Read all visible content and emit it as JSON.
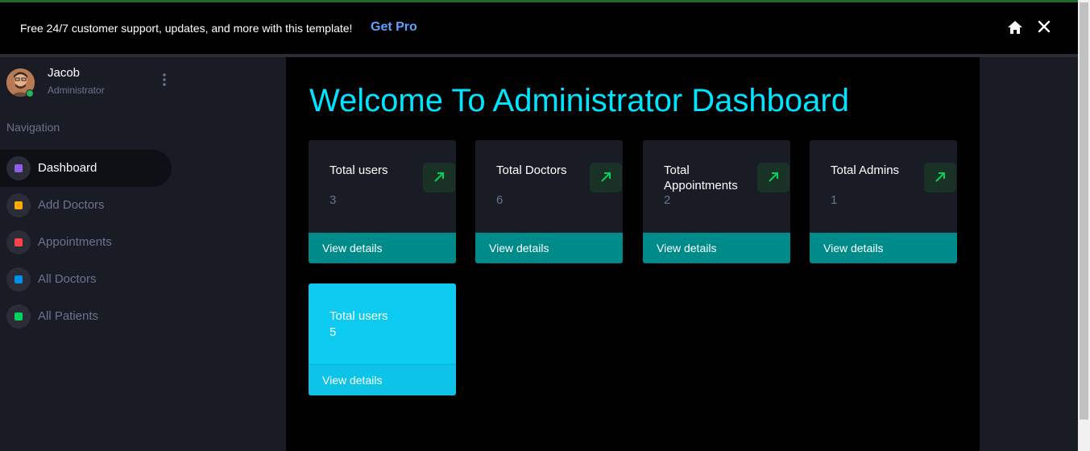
{
  "banner": {
    "message": "Free 24/7 customer support, updates, and more with this template!",
    "link_label": "Get Pro"
  },
  "profile": {
    "name": "Jacob",
    "role": "Administrator",
    "status": "online"
  },
  "sidebar": {
    "heading": "Navigation",
    "items": [
      {
        "label": "Dashboard",
        "icon_color": "#8f5fe8",
        "active": true
      },
      {
        "label": "Add Doctors",
        "icon_color": "#ffab00",
        "active": false
      },
      {
        "label": "Appointments",
        "icon_color": "#fc424a",
        "active": false
      },
      {
        "label": "All Doctors",
        "icon_color": "#0090e7",
        "active": false
      },
      {
        "label": "All Patients",
        "icon_color": "#00d25b",
        "active": false
      }
    ]
  },
  "main": {
    "welcome": "Welcome To Administrator Dashboard",
    "cards": [
      {
        "title": "Total users",
        "value": "3",
        "footer": "View details"
      },
      {
        "title": "Total Doctors",
        "value": "6",
        "footer": "View details"
      },
      {
        "title": "Total Appointments",
        "value": "2",
        "footer": "View details"
      },
      {
        "title": "Total Admins",
        "value": "1",
        "footer": "View details"
      },
      {
        "title": "Total users",
        "value": "5",
        "footer": "View details"
      }
    ]
  },
  "colors": {
    "accent_cyan": "#00e5ff",
    "footer_teal": "#008b8b",
    "highlight_card": "#0dcaf0",
    "arrow_green": "#00d25b"
  }
}
